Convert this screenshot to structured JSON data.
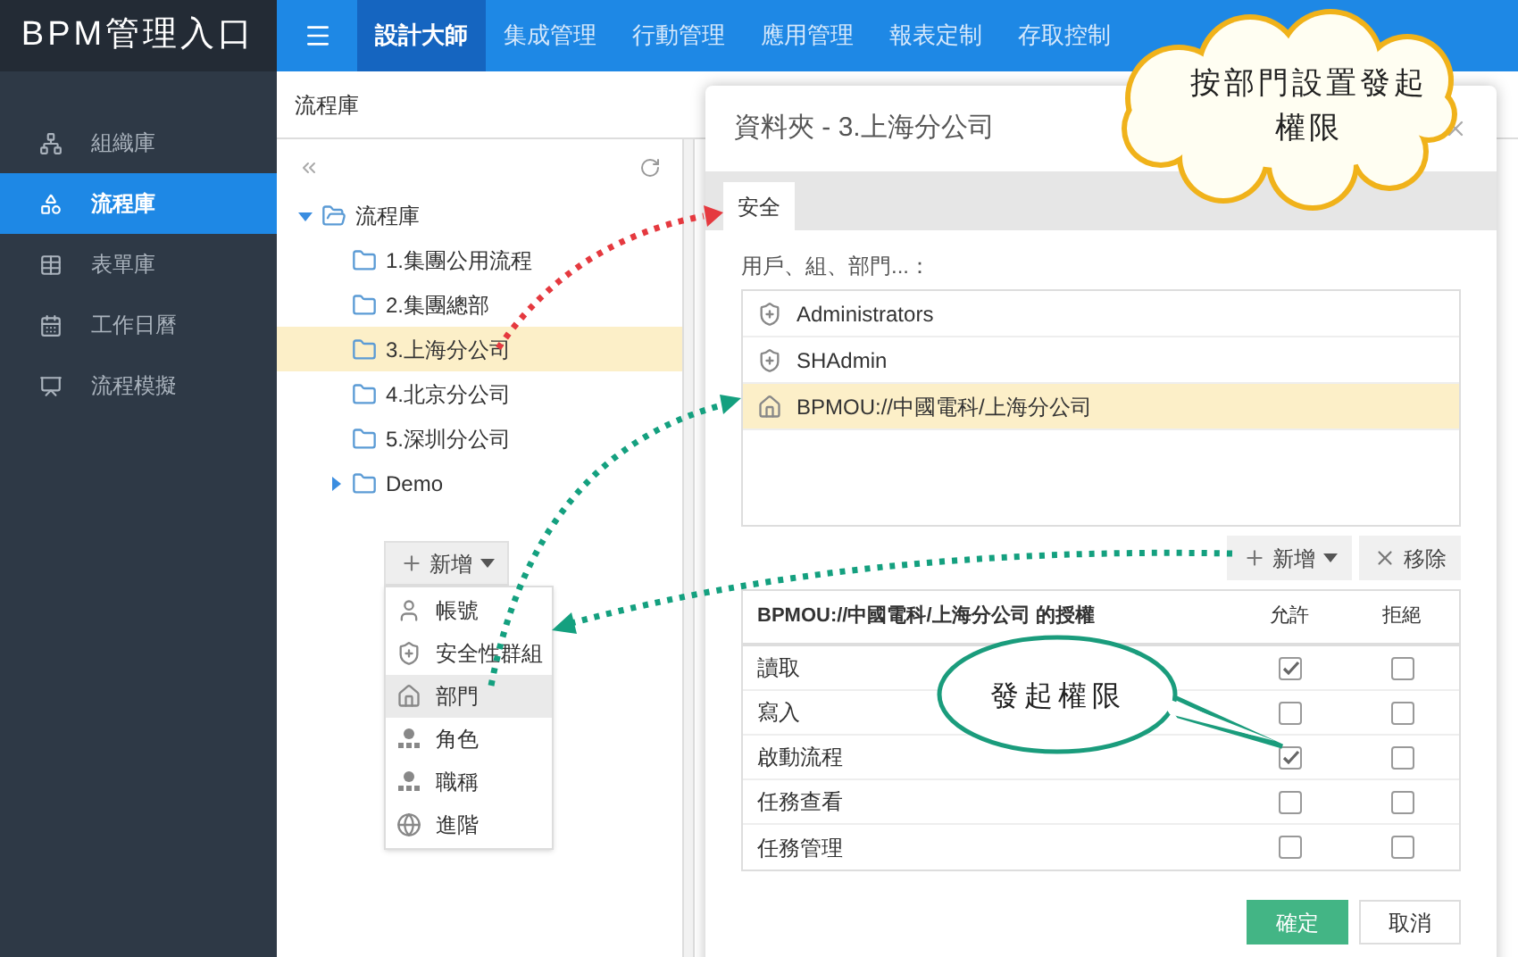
{
  "app": {
    "title": "BPM管理入口"
  },
  "top_nav": [
    {
      "label": "設計大師",
      "selected": true
    },
    {
      "label": "集成管理",
      "selected": false
    },
    {
      "label": "行動管理",
      "selected": false
    },
    {
      "label": "應用管理",
      "selected": false
    },
    {
      "label": "報表定制",
      "selected": false
    },
    {
      "label": "存取控制",
      "selected": false
    }
  ],
  "sidebar": {
    "items": [
      {
        "label": "組織庫",
        "selected": false
      },
      {
        "label": "流程庫",
        "selected": true
      },
      {
        "label": "表單庫",
        "selected": false
      },
      {
        "label": "工作日曆",
        "selected": false
      },
      {
        "label": "流程模擬",
        "selected": false
      }
    ]
  },
  "breadcrumb": "流程庫",
  "tree": {
    "root": {
      "label": "流程庫",
      "expanded": true,
      "children": [
        {
          "label": "1.集團公用流程",
          "selected": false
        },
        {
          "label": "2.集團總部",
          "selected": false
        },
        {
          "label": "3.上海分公司",
          "selected": true
        },
        {
          "label": "4.北京分公司",
          "selected": false
        },
        {
          "label": "5.深圳分公司",
          "selected": false
        },
        {
          "label": "Demo",
          "selected": false,
          "expanded": false
        }
      ]
    }
  },
  "add_menu": {
    "button": "新增",
    "items": [
      {
        "label": "帳號",
        "kind": "account",
        "selected": false
      },
      {
        "label": "安全性群組",
        "kind": "group",
        "selected": false
      },
      {
        "label": "部門",
        "kind": "department",
        "selected": true
      },
      {
        "label": "角色",
        "kind": "role",
        "selected": false
      },
      {
        "label": "職稱",
        "kind": "title",
        "selected": false
      },
      {
        "label": "進階",
        "kind": "advanced",
        "selected": false
      }
    ]
  },
  "dialog": {
    "title": "資料夾 - 3.上海分公司",
    "tabs": [
      {
        "label": "安全",
        "selected": true
      }
    ],
    "members_label": "用戶、組、部門...：",
    "members": [
      {
        "name": "Administrators",
        "kind": "group",
        "selected": false
      },
      {
        "name": "SHAdmin",
        "kind": "group",
        "selected": false
      },
      {
        "name": "BPMOU://中國電科/上海分公司",
        "kind": "department",
        "selected": true
      }
    ],
    "add_button": "新增",
    "remove_button": "移除",
    "permissions": {
      "columns": [
        "BPMOU://中國電科/上海分公司 的授權",
        "允許",
        "拒絕"
      ],
      "rows": [
        {
          "name": "讀取",
          "allow": true,
          "deny": false
        },
        {
          "name": "寫入",
          "allow": false,
          "deny": false
        },
        {
          "name": "啟動流程",
          "allow": true,
          "deny": false
        },
        {
          "name": "任務查看",
          "allow": false,
          "deny": false
        },
        {
          "name": "任務管理",
          "allow": false,
          "deny": false
        }
      ]
    },
    "ok_button": "確定",
    "cancel_button": "取消"
  },
  "annotations": [
    {
      "kind": "cloud",
      "text": "按部門設置發起權限"
    },
    {
      "kind": "bubble",
      "text": "發起權限"
    }
  ]
}
